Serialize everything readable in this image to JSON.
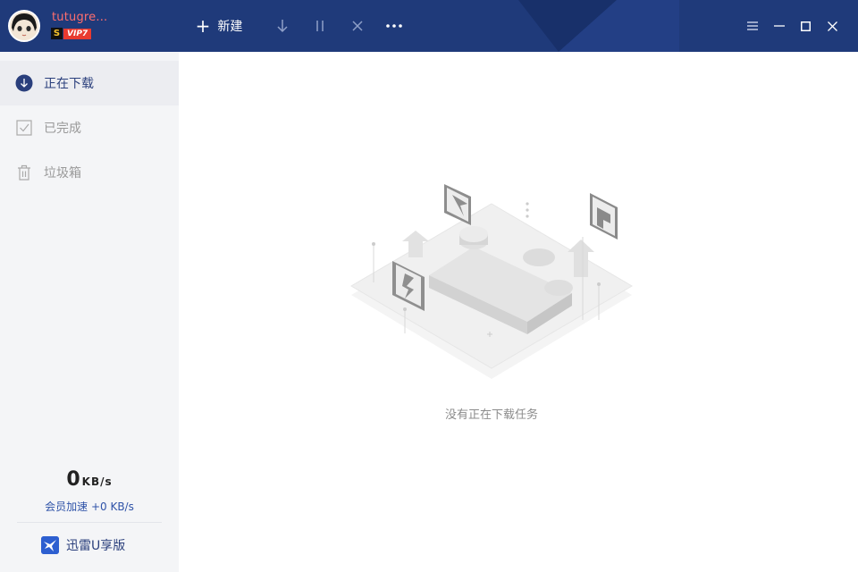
{
  "header": {
    "username": "tutugre...",
    "vip_badge_s": "S",
    "vip_level": "VIP7",
    "new_label": "新建",
    "toolbar_icons": [
      "download-arrow-icon",
      "pause-icon",
      "close-x-icon",
      "more-dots-icon"
    ],
    "window_icons": [
      "menu-icon",
      "minimize-icon",
      "maximize-icon",
      "close-icon"
    ]
  },
  "sidebar": {
    "items": [
      {
        "label": "正在下载",
        "icon": "download-circle-icon",
        "active": true
      },
      {
        "label": "已完成",
        "icon": "checkbox-icon",
        "active": false
      },
      {
        "label": "垃圾箱",
        "icon": "trash-icon",
        "active": false
      }
    ],
    "speed_value": "0",
    "speed_unit": "KB/s",
    "boost_text": "会员加速 +0 KB/s",
    "u_share_label": "迅雷U享版"
  },
  "main": {
    "empty_message": "没有正在下载任务"
  },
  "colors": {
    "titlebar": "#1f3a7a",
    "accent": "#2a3f7c",
    "username": "#ff6e6e",
    "vip": "#e83a2f"
  }
}
